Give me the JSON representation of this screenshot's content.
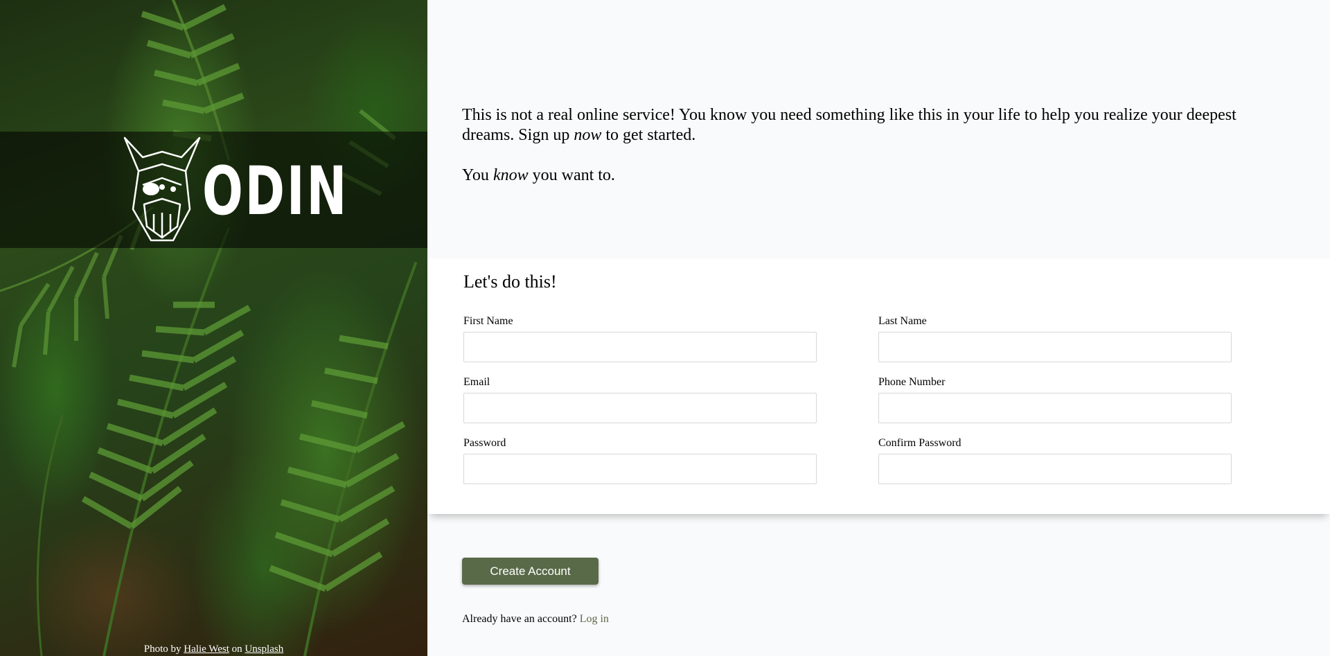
{
  "hero": {
    "logo_alt": "Odin logo",
    "logo_text": "ODIN",
    "credit": {
      "prefix": "Photo by",
      "author": "Halie West",
      "middle": "on",
      "site": "Unsplash"
    }
  },
  "intro": {
    "line1_a": "This is not a real online service! You know you need something like this in your life to help you realize your deepest dreams. Sign up ",
    "line1_em": "now",
    "line1_b": " to get started.",
    "line2_a": "You ",
    "line2_em": "know",
    "line2_b": " you want to."
  },
  "form": {
    "title": "Let's do this!",
    "fields": {
      "first_name": {
        "label": "First Name",
        "value": ""
      },
      "last_name": {
        "label": "Last Name",
        "value": ""
      },
      "email": {
        "label": "Email",
        "value": ""
      },
      "phone": {
        "label": "Phone Number",
        "value": ""
      },
      "password": {
        "label": "Password",
        "value": ""
      },
      "confirm_password": {
        "label": "Confirm Password",
        "value": ""
      }
    }
  },
  "actions": {
    "create_label": "Create Account",
    "login_prompt": "Already have an account?",
    "login_link": "Log in"
  },
  "colors": {
    "accent": "#596a48",
    "page_bg": "#f9fafb",
    "card_bg": "#ffffff"
  }
}
